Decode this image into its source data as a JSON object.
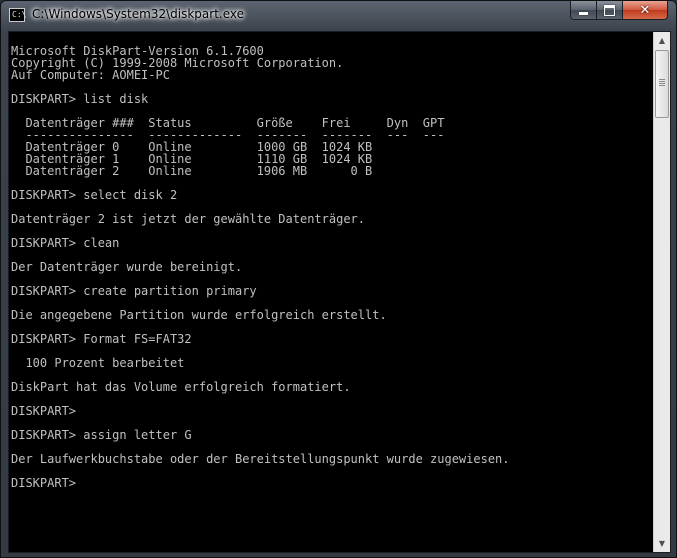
{
  "window": {
    "title": "C:\\Windows\\System32\\diskpart.exe",
    "icon": "console-app-icon",
    "icon_glyph": "C:\\"
  },
  "caption": {
    "minimize_icon": "minimize-icon",
    "maximize_icon": "maximize-icon",
    "close_icon": "close-icon",
    "close_glyph": "✕"
  },
  "console": {
    "lines": [
      "Microsoft DiskPart-Version 6.1.7600",
      "Copyright (C) 1999-2008 Microsoft Corporation.",
      "Auf Computer: AOMEI-PC",
      "",
      "DISKPART> list disk",
      "",
      "  Datenträger ###  Status         Größe    Frei     Dyn  GPT",
      "  ---------------  -------------  -------  -------  ---  ---",
      "  Datenträger 0    Online         1000 GB  1024 KB",
      "  Datenträger 1    Online         1110 GB  1024 KB",
      "  Datenträger 2    Online         1906 MB      0 B",
      "",
      "DISKPART> select disk 2",
      "",
      "Datenträger 2 ist jetzt der gewählte Datenträger.",
      "",
      "DISKPART> clean",
      "",
      "Der Datenträger wurde bereinigt.",
      "",
      "DISKPART> create partition primary",
      "",
      "Die angegebene Partition wurde erfolgreich erstellt.",
      "",
      "DISKPART> Format FS=FAT32",
      "",
      "  100 Prozent bearbeitet",
      "",
      "DiskPart hat das Volume erfolgreich formatiert.",
      "",
      "DISKPART>",
      "",
      "DISKPART> assign letter G",
      "",
      "Der Laufwerkbuchstabe oder der Bereitstellungspunkt wurde zugewiesen.",
      "",
      "DISKPART>"
    ],
    "text_color": "#c0c0c0",
    "background": "#000000"
  },
  "scrollbar": {
    "up_arrow": "▲",
    "down_arrow": "▼",
    "position": 0.0
  }
}
